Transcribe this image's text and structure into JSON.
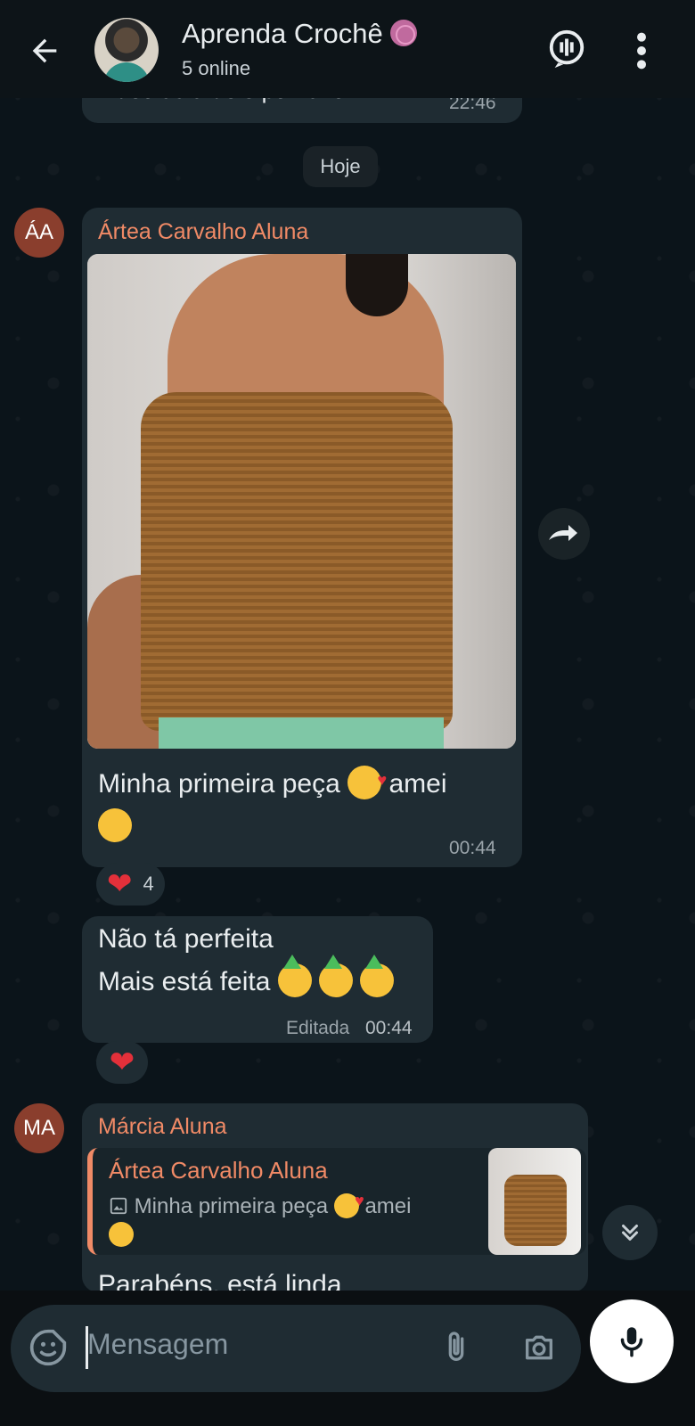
{
  "header": {
    "title": "Aprenda Crochê",
    "subtitle": "5 online"
  },
  "messages": {
    "previous": {
      "text": "vídeo aula dele por favor",
      "time": "22:46"
    },
    "date_divider": "Hoje",
    "msg1": {
      "avatar_initials": "ÁA",
      "sender": "Ártea Carvalho Aluna",
      "text_a": "Minha primeira peça",
      "text_b": "amei",
      "time": "00:44",
      "reaction_count": "4"
    },
    "msg2": {
      "line1": "Não tá perfeita",
      "line2": "Mais está feita",
      "edited": "Editada",
      "time": "00:44"
    },
    "msg3": {
      "avatar_initials": "MA",
      "sender": "Márcia Aluna",
      "quote_sender": "Ártea Carvalho Aluna",
      "quote_text_a": "Minha primeira peça",
      "quote_text_b": "amei",
      "text": "Parabéns, está linda"
    }
  },
  "composer": {
    "placeholder": "Mensagem"
  },
  "colors": {
    "accent_name": "#f08a66",
    "bubble": "#1f2c33",
    "background": "#0b141a"
  },
  "icons": [
    "back-arrow-icon",
    "yarn-emoji-icon",
    "voice-chat-icon",
    "more-vert-icon",
    "forward-icon",
    "scroll-down-icon",
    "sticker-icon",
    "attach-icon",
    "camera-icon",
    "mic-icon",
    "image-icon",
    "heart-icon"
  ]
}
